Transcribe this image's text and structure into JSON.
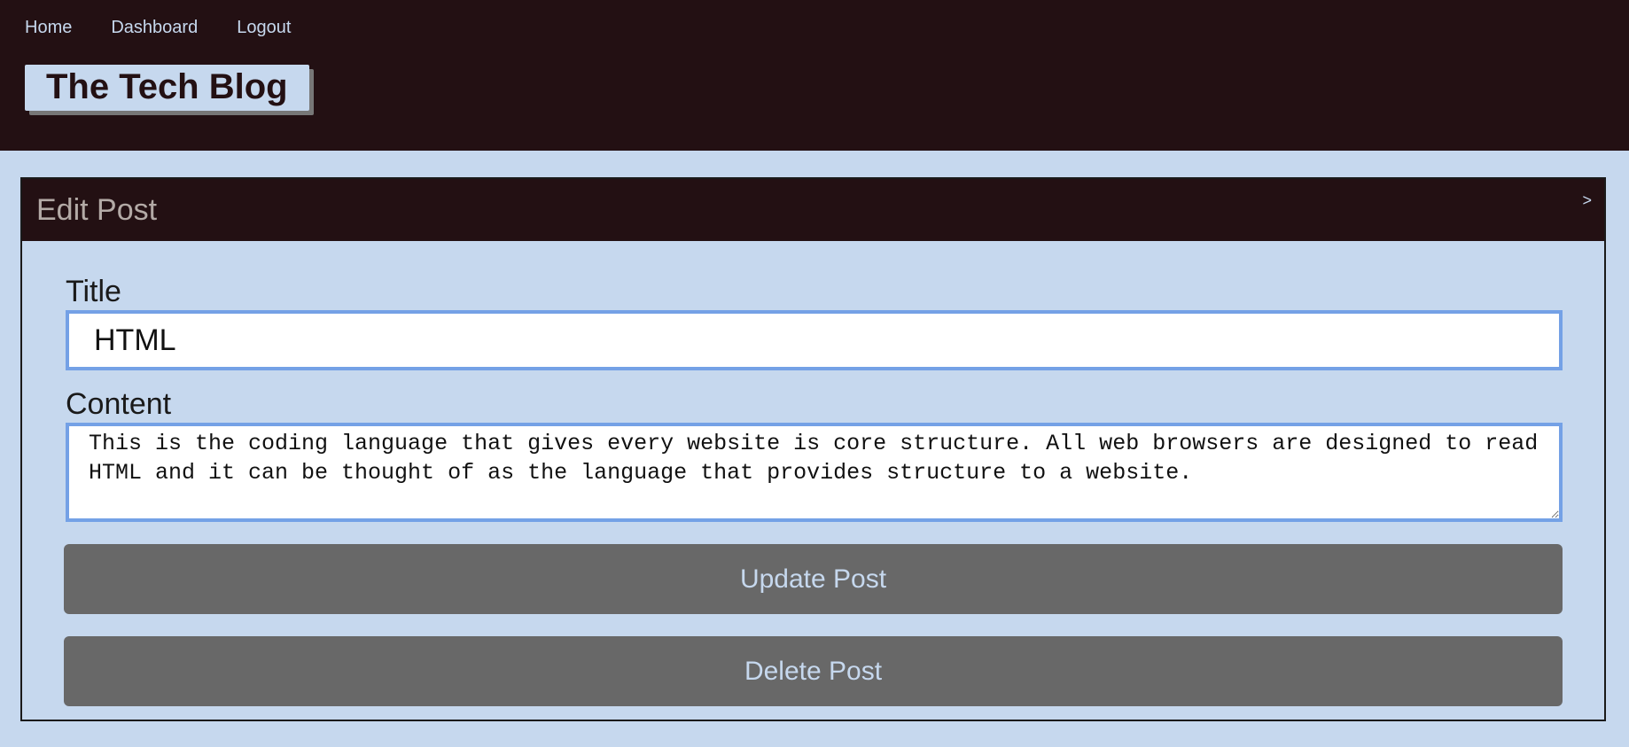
{
  "nav": {
    "home": "Home",
    "dashboard": "Dashboard",
    "logout": "Logout"
  },
  "brand": "The Tech Blog",
  "card": {
    "title": "Edit Post",
    "toggle": ">"
  },
  "form": {
    "title_label": "Title",
    "title_value": "HTML",
    "content_label": "Content",
    "content_value": "This is the coding language that gives every website is core structure. All web browsers are designed to read HTML and it can be thought of as the language that provides structure to a website.",
    "update_label": "Update Post",
    "delete_label": "Delete Post"
  },
  "colors": {
    "header_bg": "#231013",
    "page_bg": "#c6d8ee",
    "input_border": "#74a1e6",
    "button_bg": "#686868"
  }
}
